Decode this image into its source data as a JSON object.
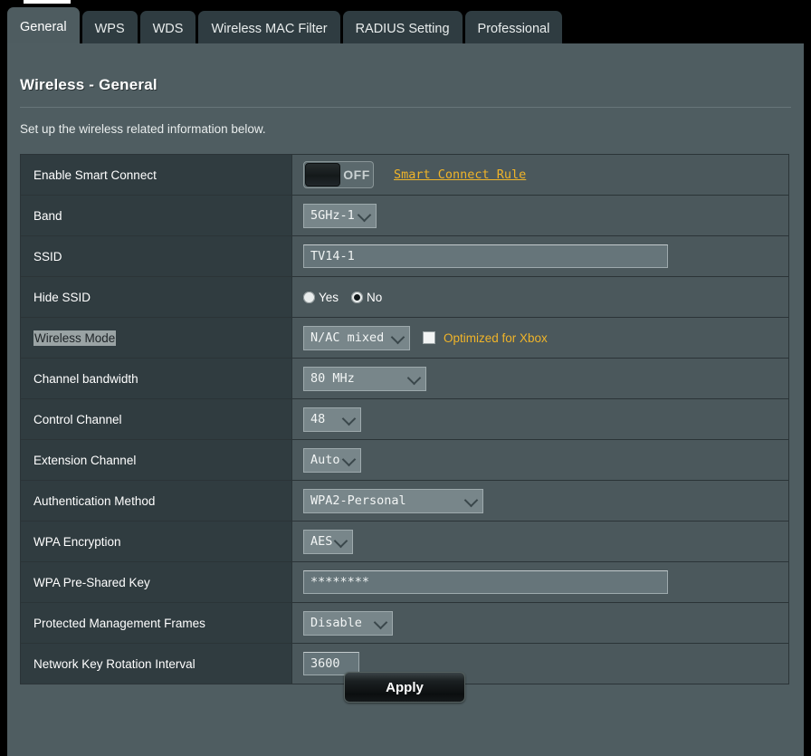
{
  "window": {
    "title": "Wireless - General"
  },
  "tabs": [
    {
      "label": "General",
      "active": true
    },
    {
      "label": "WPS",
      "active": false
    },
    {
      "label": "WDS",
      "active": false
    },
    {
      "label": "Wireless MAC Filter",
      "active": false
    },
    {
      "label": "RADIUS Setting",
      "active": false
    },
    {
      "label": "Professional",
      "active": false
    }
  ],
  "header": {
    "title": "Wireless - General",
    "subtitle": "Set up the wireless related information below."
  },
  "rows": {
    "smart_connect": {
      "label": "Enable Smart Connect",
      "toggle_state": "OFF",
      "link_label": "Smart Connect Rule"
    },
    "band": {
      "label": "Band",
      "value": "5GHz-1"
    },
    "ssid": {
      "label": "SSID",
      "value": "TV14-1"
    },
    "hide_ssid": {
      "label": "Hide SSID",
      "options": [
        "Yes",
        "No"
      ],
      "selected": "No"
    },
    "wireless_mode": {
      "label": "Wireless Mode",
      "value": "N/AC mixed",
      "checkbox_label": "Optimized for Xbox",
      "checkbox_checked": false
    },
    "channel_bandwidth": {
      "label": "Channel bandwidth",
      "value": "80 MHz"
    },
    "control_channel": {
      "label": "Control Channel",
      "value": "48"
    },
    "extension_channel": {
      "label": "Extension Channel",
      "value": "Auto"
    },
    "authentication_method": {
      "label": "Authentication Method",
      "value": "WPA2-Personal"
    },
    "wpa_encryption": {
      "label": "WPA Encryption",
      "value": "AES"
    },
    "wpa_psk": {
      "label": "WPA Pre-Shared Key",
      "value": "********"
    },
    "pmf": {
      "label": "Protected Management Frames",
      "value": "Disable"
    },
    "key_rotation": {
      "label": "Network Key Rotation Interval",
      "value": "3600"
    }
  },
  "footer": {
    "apply_label": "Apply"
  },
  "colors": {
    "accent_link": "#f0b429",
    "panel_bg": "#4f5d61",
    "label_col_bg": "#303c40",
    "value_col_bg": "#4b585c",
    "active_tab_bg": "#4e5c60",
    "inactive_tab_bg": "#2f3c41"
  }
}
